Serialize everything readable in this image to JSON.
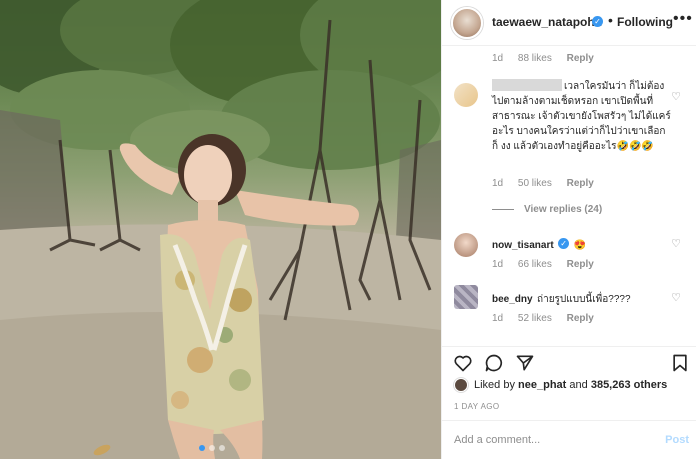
{
  "post": {
    "username": "taewaew_natapohn",
    "follow_label": "Following",
    "separator": "•",
    "more": "•••"
  },
  "comments": [
    {
      "id": "c0",
      "likes": "88 likes",
      "reply": "Reply",
      "time": "1d"
    },
    {
      "id": "c1",
      "user": "",
      "text": "เวลาใครมันว่า ก็ไม่ต้องไปตามล้างตามเช็ดหรอก เขาเปิดพื้นที่สาธารณะ เจ้าตัวเขายังโพสรัวๆ ไม่ได้แคร์อะไร บางคนใครว่าแต่ว่าก็ไปว่าเขาเลือก ก็ งง แล้วตัวเองทำอยู่คืออะไร🤣🤣🤣",
      "time": "1d",
      "likes": "50 likes",
      "reply": "Reply",
      "view_replies": "View replies (24)"
    },
    {
      "id": "c2",
      "user": "now_tisanart",
      "text": "😍",
      "time": "1d",
      "likes": "66 likes",
      "reply": "Reply"
    },
    {
      "id": "c3",
      "user": "bee_dny",
      "text": "ถ่ายรูปแบบนี้เพื่อ????",
      "time": "1d",
      "likes": "52 likes",
      "reply": "Reply"
    }
  ],
  "likes_line": {
    "prefix": "Liked by",
    "user": "nee_phat",
    "middle": "and",
    "count": "385,263 others"
  },
  "timestamp": "1 DAY AGO",
  "add_comment": {
    "placeholder": "Add a comment...",
    "post_label": "Post"
  },
  "colors": {
    "verified_blue": "#3897f0",
    "post_disabled": "#b3dbff",
    "muted": "#8e8e8e"
  },
  "icons": [
    "heart-icon",
    "comment-icon",
    "share-icon",
    "bookmark-icon",
    "more-icon",
    "verified-icon"
  ]
}
